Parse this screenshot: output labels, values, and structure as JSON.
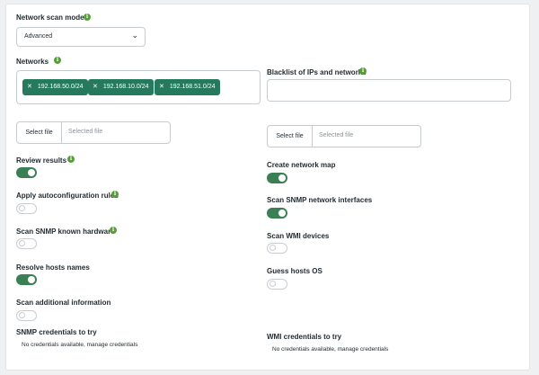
{
  "scan_mode": {
    "label": "Network scan mode",
    "value": "Advanced"
  },
  "networks": {
    "label": "Networks",
    "tags": [
      "192.168.50.0/24",
      "192.168.10.0/24",
      "192.168.51.0/24"
    ]
  },
  "blacklist": {
    "label": "Blacklist of IPs and networks",
    "value": ""
  },
  "file_left": {
    "button": "Select file",
    "placeholder": "Selected file"
  },
  "file_right": {
    "button": "Select file",
    "placeholder": "Selected file"
  },
  "toggles": {
    "review_results": {
      "label": "Review results",
      "on": true
    },
    "apply_autoconfig": {
      "label": "Apply autoconfiguration rules",
      "on": false
    },
    "scan_snmp_hardware": {
      "label": "Scan SNMP known hardware",
      "on": false
    },
    "resolve_hosts": {
      "label": "Resolve hosts names",
      "on": true
    },
    "scan_additional": {
      "label": "Scan additional information",
      "on": false
    },
    "create_network_map": {
      "label": "Create network map",
      "on": true
    },
    "scan_snmp_interfaces": {
      "label": "Scan SNMP network interfaces",
      "on": true
    },
    "scan_wmi": {
      "label": "Scan WMI devices",
      "on": false
    },
    "guess_os": {
      "label": "Guess hosts OS",
      "on": false
    }
  },
  "snmp_credentials": {
    "label": "SNMP credentials to try",
    "note": "No credentials available, manage credentials"
  },
  "wmi_credentials": {
    "label": "WMI credentials to try",
    "note": "No credentials available, manage credentials"
  },
  "icons": {
    "info": "info-icon",
    "chevron": "chevron-down-icon",
    "remove": "close-icon"
  },
  "colors": {
    "accent": "#3b7f54",
    "tag": "#257a5d",
    "info": "#5a9e3c"
  }
}
